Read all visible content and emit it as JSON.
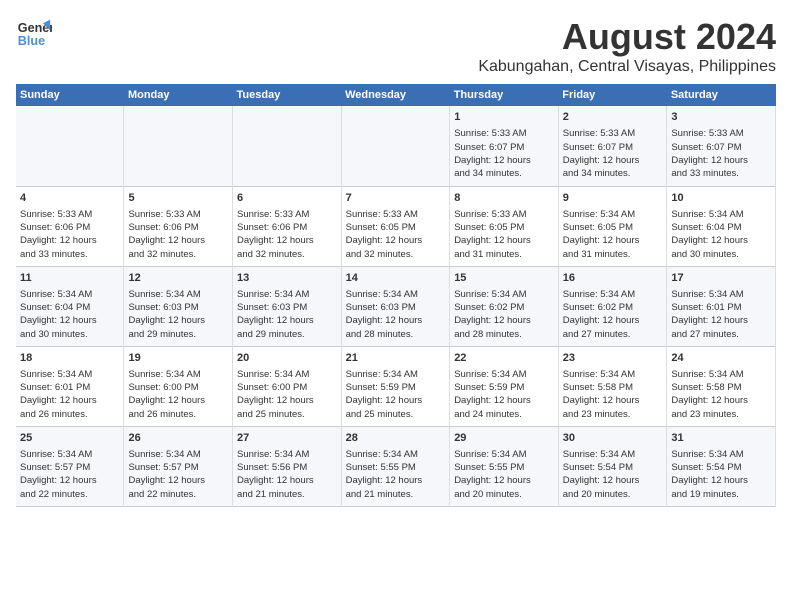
{
  "logo": {
    "line1": "General",
    "line2": "Blue"
  },
  "title": "August 2024",
  "subtitle": "Kabungahan, Central Visayas, Philippines",
  "days_header": [
    "Sunday",
    "Monday",
    "Tuesday",
    "Wednesday",
    "Thursday",
    "Friday",
    "Saturday"
  ],
  "weeks": [
    {
      "days": [
        {
          "num": "",
          "info": ""
        },
        {
          "num": "",
          "info": ""
        },
        {
          "num": "",
          "info": ""
        },
        {
          "num": "",
          "info": ""
        },
        {
          "num": "1",
          "info": "Sunrise: 5:33 AM\nSunset: 6:07 PM\nDaylight: 12 hours\nand 34 minutes."
        },
        {
          "num": "2",
          "info": "Sunrise: 5:33 AM\nSunset: 6:07 PM\nDaylight: 12 hours\nand 34 minutes."
        },
        {
          "num": "3",
          "info": "Sunrise: 5:33 AM\nSunset: 6:07 PM\nDaylight: 12 hours\nand 33 minutes."
        }
      ]
    },
    {
      "days": [
        {
          "num": "4",
          "info": "Sunrise: 5:33 AM\nSunset: 6:06 PM\nDaylight: 12 hours\nand 33 minutes."
        },
        {
          "num": "5",
          "info": "Sunrise: 5:33 AM\nSunset: 6:06 PM\nDaylight: 12 hours\nand 32 minutes."
        },
        {
          "num": "6",
          "info": "Sunrise: 5:33 AM\nSunset: 6:06 PM\nDaylight: 12 hours\nand 32 minutes."
        },
        {
          "num": "7",
          "info": "Sunrise: 5:33 AM\nSunset: 6:05 PM\nDaylight: 12 hours\nand 32 minutes."
        },
        {
          "num": "8",
          "info": "Sunrise: 5:33 AM\nSunset: 6:05 PM\nDaylight: 12 hours\nand 31 minutes."
        },
        {
          "num": "9",
          "info": "Sunrise: 5:34 AM\nSunset: 6:05 PM\nDaylight: 12 hours\nand 31 minutes."
        },
        {
          "num": "10",
          "info": "Sunrise: 5:34 AM\nSunset: 6:04 PM\nDaylight: 12 hours\nand 30 minutes."
        }
      ]
    },
    {
      "days": [
        {
          "num": "11",
          "info": "Sunrise: 5:34 AM\nSunset: 6:04 PM\nDaylight: 12 hours\nand 30 minutes."
        },
        {
          "num": "12",
          "info": "Sunrise: 5:34 AM\nSunset: 6:03 PM\nDaylight: 12 hours\nand 29 minutes."
        },
        {
          "num": "13",
          "info": "Sunrise: 5:34 AM\nSunset: 6:03 PM\nDaylight: 12 hours\nand 29 minutes."
        },
        {
          "num": "14",
          "info": "Sunrise: 5:34 AM\nSunset: 6:03 PM\nDaylight: 12 hours\nand 28 minutes."
        },
        {
          "num": "15",
          "info": "Sunrise: 5:34 AM\nSunset: 6:02 PM\nDaylight: 12 hours\nand 28 minutes."
        },
        {
          "num": "16",
          "info": "Sunrise: 5:34 AM\nSunset: 6:02 PM\nDaylight: 12 hours\nand 27 minutes."
        },
        {
          "num": "17",
          "info": "Sunrise: 5:34 AM\nSunset: 6:01 PM\nDaylight: 12 hours\nand 27 minutes."
        }
      ]
    },
    {
      "days": [
        {
          "num": "18",
          "info": "Sunrise: 5:34 AM\nSunset: 6:01 PM\nDaylight: 12 hours\nand 26 minutes."
        },
        {
          "num": "19",
          "info": "Sunrise: 5:34 AM\nSunset: 6:00 PM\nDaylight: 12 hours\nand 26 minutes."
        },
        {
          "num": "20",
          "info": "Sunrise: 5:34 AM\nSunset: 6:00 PM\nDaylight: 12 hours\nand 25 minutes."
        },
        {
          "num": "21",
          "info": "Sunrise: 5:34 AM\nSunset: 5:59 PM\nDaylight: 12 hours\nand 25 minutes."
        },
        {
          "num": "22",
          "info": "Sunrise: 5:34 AM\nSunset: 5:59 PM\nDaylight: 12 hours\nand 24 minutes."
        },
        {
          "num": "23",
          "info": "Sunrise: 5:34 AM\nSunset: 5:58 PM\nDaylight: 12 hours\nand 23 minutes."
        },
        {
          "num": "24",
          "info": "Sunrise: 5:34 AM\nSunset: 5:58 PM\nDaylight: 12 hours\nand 23 minutes."
        }
      ]
    },
    {
      "days": [
        {
          "num": "25",
          "info": "Sunrise: 5:34 AM\nSunset: 5:57 PM\nDaylight: 12 hours\nand 22 minutes."
        },
        {
          "num": "26",
          "info": "Sunrise: 5:34 AM\nSunset: 5:57 PM\nDaylight: 12 hours\nand 22 minutes."
        },
        {
          "num": "27",
          "info": "Sunrise: 5:34 AM\nSunset: 5:56 PM\nDaylight: 12 hours\nand 21 minutes."
        },
        {
          "num": "28",
          "info": "Sunrise: 5:34 AM\nSunset: 5:55 PM\nDaylight: 12 hours\nand 21 minutes."
        },
        {
          "num": "29",
          "info": "Sunrise: 5:34 AM\nSunset: 5:55 PM\nDaylight: 12 hours\nand 20 minutes."
        },
        {
          "num": "30",
          "info": "Sunrise: 5:34 AM\nSunset: 5:54 PM\nDaylight: 12 hours\nand 20 minutes."
        },
        {
          "num": "31",
          "info": "Sunrise: 5:34 AM\nSunset: 5:54 PM\nDaylight: 12 hours\nand 19 minutes."
        }
      ]
    }
  ]
}
